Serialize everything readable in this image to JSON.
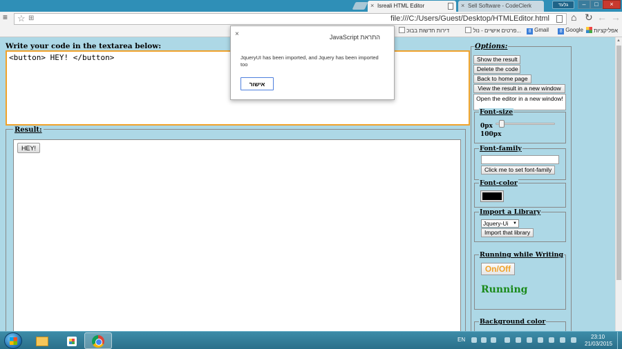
{
  "browser": {
    "tabs": [
      {
        "title": "Isreali HTML Editor",
        "active": true
      },
      {
        "title": "Sell Software - CodeClerk",
        "active": false
      }
    ],
    "user_badge": "גלעד",
    "url": "file:///C:/Users/Guest/Desktop/HTMLEditor.html",
    "bookmarks": [
      {
        "label": "אפליקציות",
        "icon": "apps-grid-icon"
      },
      {
        "label": "Google",
        "icon": "google-icon"
      },
      {
        "label": "Gmail",
        "icon": "google-icon"
      },
      {
        "label": "פרטים אישיים - נול...",
        "icon": "page-icon"
      },
      {
        "label": "דירות חדשות בבוכ",
        "icon": "page-icon"
      }
    ]
  },
  "editor": {
    "code_label": "Write your code in the textarea below:",
    "code": "<button> HEY! </button>",
    "result_legend": "Result:",
    "result_button": "HEY!"
  },
  "options": {
    "legend": "Options:",
    "buttons": {
      "show": "Show the result",
      "delete": "Delete the code",
      "home": "Back to home page",
      "new_window": "View the result in a new window",
      "editor_window": "Open the editor in a new window!"
    },
    "font_size": {
      "legend": "Font-size",
      "min_label": "0px",
      "max_label": "100px",
      "slider_fraction": 0.1
    },
    "font_family": {
      "legend": "Font-family",
      "input_value": "",
      "button": "Click me to set font-family"
    },
    "font_color": {
      "legend": "Font-color",
      "value": "#000000"
    },
    "library": {
      "legend": "Import a Library",
      "selected": "Jquery-Ui",
      "button": "Import that library"
    },
    "running": {
      "legend": "Running while Writing",
      "toggle": "On/Off",
      "status": "Running"
    },
    "background": {
      "legend": "Background color"
    }
  },
  "alert": {
    "title": "התראת JavaScript",
    "message": "JqueryUI has been imported, and Jquery has been imported too",
    "ok": "אישור"
  },
  "taskbar": {
    "lang": "EN",
    "time": "23:10",
    "date": "21/03/2015"
  },
  "colors": {
    "page_bg": "#add8e6",
    "accent_orange": "#f0a22a",
    "running_green": "#1a8a1a",
    "chrome_frame": "#2f8fb7"
  }
}
